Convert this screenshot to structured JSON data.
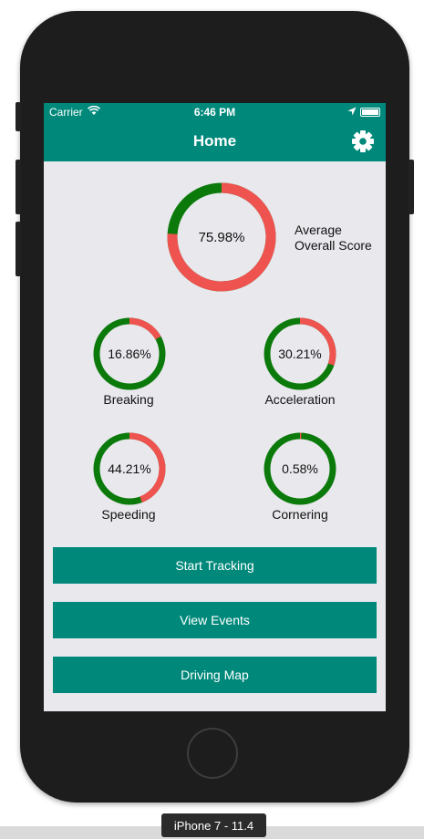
{
  "status_bar": {
    "carrier": "Carrier",
    "time": "6:46 PM"
  },
  "nav": {
    "title": "Home",
    "settings_icon": "gear-icon"
  },
  "overall": {
    "value": 75.98,
    "text": "75.98%",
    "label_line1": "Average",
    "label_line2": "Overall Score"
  },
  "metrics": [
    {
      "label": "Breaking",
      "value": 16.86,
      "text": "16.86%"
    },
    {
      "label": "Acceleration",
      "value": 30.21,
      "text": "30.21%"
    },
    {
      "label": "Speeding",
      "value": 44.21,
      "text": "44.21%"
    },
    {
      "label": "Cornering",
      "value": 0.58,
      "text": "0.58%"
    }
  ],
  "buttons": {
    "start": "Start Tracking",
    "events": "View Events",
    "map": "Driving Map"
  },
  "simulator": {
    "label": "iPhone 7 - 11.4"
  },
  "colors": {
    "accent": "#00897b",
    "ring_good": "#0b7a0b",
    "ring_bad": "#ef5350"
  }
}
